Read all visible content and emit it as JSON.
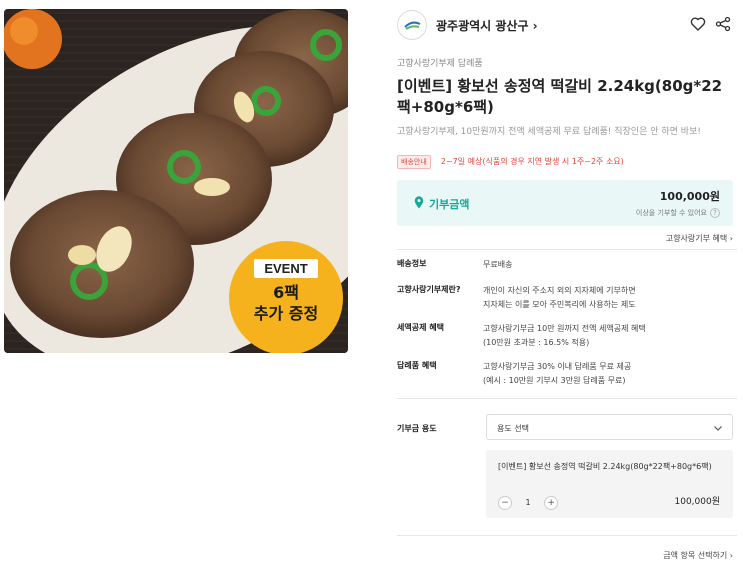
{
  "product_image": {
    "alt": "",
    "badge": {
      "tag": "EVENT",
      "line1": "6팩",
      "line2": "추가 증정"
    }
  },
  "seller": {
    "name": "광주광역시 광산구 ›",
    "logo_icon": "gwangsan-logo-icon"
  },
  "header_icons": {
    "favorite": "heart-icon",
    "share": "share-icon"
  },
  "category": "고향사랑기부제 답례품",
  "title": "[이벤트] 황보선 송정역 떡갈비 2.24kg(80g*22팩+80g*6팩)",
  "subtitle": "고향사랑기부제, 10만원까지 전액 세액공제 무료 답례품! 직장인은 안 하면 바보!",
  "delivery": {
    "badge": "배송안내",
    "text": "2~7일 예상(식품의 경우 지연 발생 시 1주~2주 소요)"
  },
  "donation": {
    "label": "기부금액",
    "amount": "100,000원",
    "note": "이상을 기부할 수 있어요",
    "help": "?",
    "accent_color": "#18a79b"
  },
  "benefit_link": "고향사랑기부 혜택 ›",
  "info": [
    {
      "label": "배송정보",
      "value": "무료배송"
    },
    {
      "label": "고향사랑기부제란?",
      "value": "개인이 자신의 주소지 외의 지자체에 기부하면\n지자체는 이를 모아 주민복리에 사용하는 제도"
    },
    {
      "label": "세액공제 혜택",
      "value": "고향사랑기부금 10만 원까지 전액 세액공제 혜택\n(10만원 초과분 : 16.5% 적용)"
    },
    {
      "label": "답례품 혜택",
      "value": "고향사랑기부금 30% 이내 답례품 무료 제공\n(예시 : 10만원 기부시 3만원 답례품 무료)"
    }
  ],
  "purpose": {
    "label": "기부금 용도",
    "select_value": "용도 선택"
  },
  "option": {
    "name": "[이벤트] 황보선 송정역 떡갈비 2.24kg(80g*22팩+80g*6팩)",
    "minus": "−",
    "qty": "1",
    "plus": "+",
    "price": "100,000원"
  },
  "footer_link": "금액 항목 선택하기 ›"
}
